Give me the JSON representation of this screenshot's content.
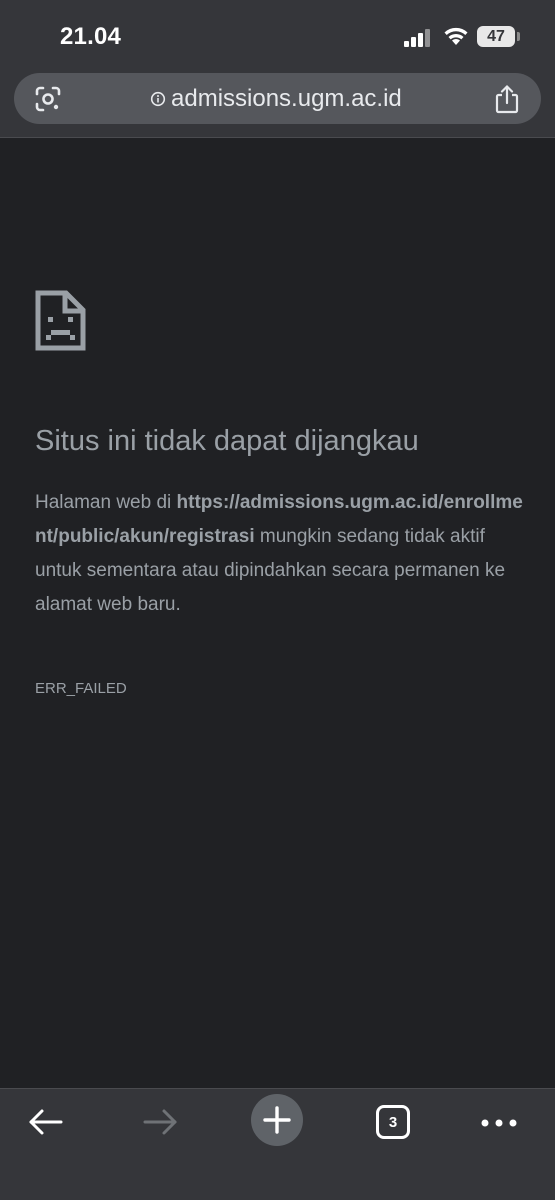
{
  "status_bar": {
    "time": "21.04",
    "battery": "47"
  },
  "browser": {
    "url": "admissions.ugm.ac.id",
    "tab_count": "3"
  },
  "error_page": {
    "title": "Situs ini tidak dapat dijangkau",
    "body_prefix": "Halaman web di ",
    "body_url": "https://admissions.ugm.ac.id/enrollment/public/akun/registrasi",
    "body_suffix": " mungkin sedang tidak aktif untuk sementara atau dipindahkan secara permanen ke alamat web baru.",
    "error_code": "ERR_FAILED"
  },
  "icons": {
    "lens": "lens-icon",
    "info": "info-icon",
    "share": "share-icon",
    "error": "sad-document-icon",
    "back": "arrow-left-icon",
    "forward": "arrow-right-icon",
    "new_tab": "plus-icon",
    "tabs": "tabs-icon",
    "more": "more-horizontal-icon"
  },
  "colors": {
    "page_background": "#202124",
    "chrome_background": "#35363a",
    "url_bar_background": "#55575c",
    "text_muted": "#9aa0a6"
  }
}
